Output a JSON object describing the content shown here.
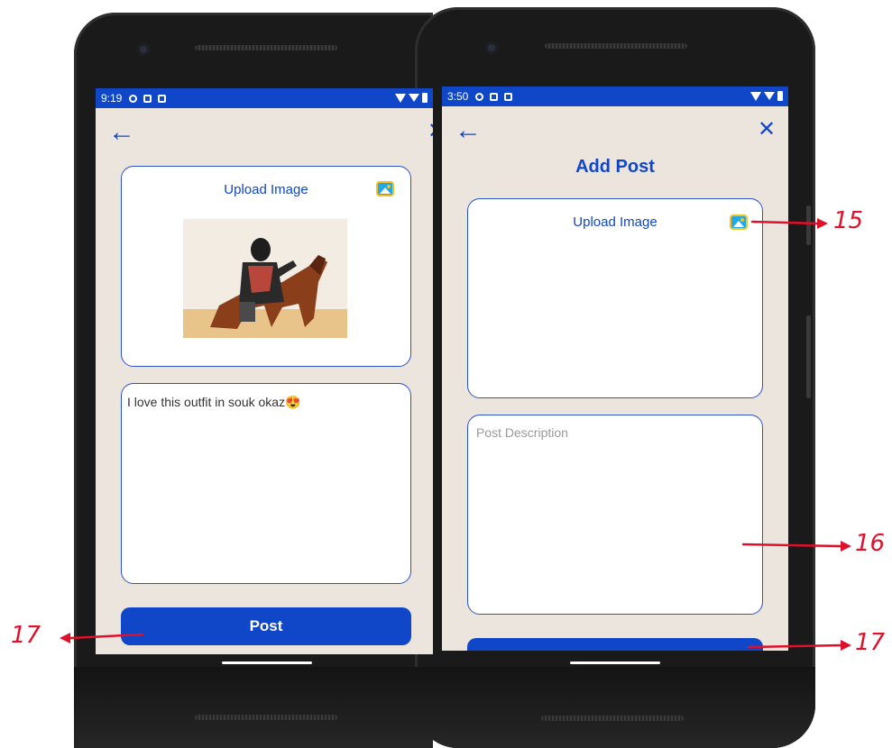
{
  "left_phone": {
    "status": {
      "time": "9:19"
    },
    "upload_label": "Upload Image",
    "description": "I love this outfit in souk okaz😍",
    "post_button": "Post"
  },
  "right_phone": {
    "status": {
      "time": "3:50"
    },
    "page_title": "Add Post",
    "upload_label": "Upload Image",
    "description_placeholder": "Post Description"
  },
  "annotations": {
    "label_15": "15",
    "label_16": "16",
    "label_17_right": "17",
    "label_17_left": "17"
  },
  "colors": {
    "primary": "#1046c8",
    "screen_bg": "#ebe5dd",
    "annotation": "#e0102a",
    "card_border": "#2a52c9"
  },
  "icons": [
    "back-arrow-icon",
    "close-icon",
    "image-upload-icon",
    "wifi-icon",
    "signal-icon",
    "battery-icon"
  ]
}
